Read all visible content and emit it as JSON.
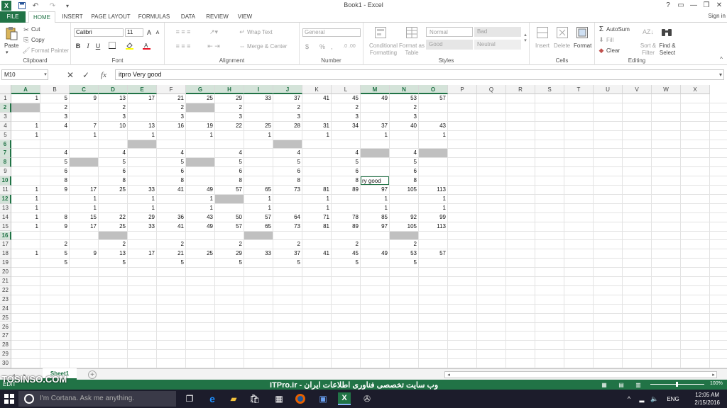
{
  "titlebar": {
    "title": "Book1 - Excel",
    "help": "?",
    "minimize": "—",
    "restore": "❐",
    "close": "✕"
  },
  "tabs": [
    "FILE",
    "HOME",
    "INSERT",
    "PAGE LAYOUT",
    "FORMULAS",
    "DATA",
    "REVIEW",
    "VIEW"
  ],
  "active_tab": "HOME",
  "signin": "Sign in",
  "ribbon": {
    "clipboard": {
      "label": "Clipboard",
      "paste": "Paste",
      "cut": "Cut",
      "copy": "Copy",
      "format_painter": "Format Painter"
    },
    "font": {
      "label": "Font",
      "name": "Calibri",
      "size": "11",
      "bold": "B",
      "italic": "I",
      "underline": "U"
    },
    "alignment": {
      "label": "Alignment",
      "wrap": "Wrap Text",
      "merge": "Merge & Center"
    },
    "number": {
      "label": "Number",
      "format": "General",
      "currency": "$",
      "percent": "%",
      "comma": ","
    },
    "styles": {
      "label": "Styles",
      "conditional": "Conditional Formatting",
      "format_table": "Format as Table",
      "normal": "Normal",
      "bad": "Bad",
      "good": "Good",
      "neutral": "Neutral"
    },
    "cells": {
      "label": "Cells",
      "insert": "Insert",
      "delete": "Delete",
      "format": "Format"
    },
    "editing": {
      "label": "Editing",
      "autosum": "AutoSum",
      "fill": "Fill",
      "clear": "Clear",
      "sort": "Sort & Filter",
      "find": "Find & Select"
    }
  },
  "formula_bar": {
    "name_box": "M10",
    "fx": "fx",
    "value": "itpro Very good"
  },
  "columns": [
    "A",
    "B",
    "C",
    "D",
    "E",
    "F",
    "G",
    "H",
    "I",
    "J",
    "K",
    "L",
    "M",
    "N",
    "O",
    "P",
    "Q",
    "R",
    "S",
    "T",
    "U",
    "V",
    "W",
    "X"
  ],
  "selected_columns": [
    "A",
    "C",
    "D",
    "E",
    "G",
    "H",
    "I",
    "J",
    "M",
    "N",
    "O"
  ],
  "rows": [
    "1",
    "2",
    "3",
    "4",
    "5",
    "6",
    "7",
    "8",
    "9",
    "10",
    "11",
    "12",
    "13",
    "14",
    "15",
    "16",
    "17",
    "18",
    "19",
    "20",
    "21",
    "22",
    "23",
    "24",
    "25",
    "26",
    "27",
    "28",
    "29",
    "30"
  ],
  "selected_rows": [
    "2",
    "6",
    "7",
    "8",
    "10",
    "12",
    "16"
  ],
  "cells": [
    [
      "1",
      "5",
      "9",
      "13",
      "17",
      "21",
      "25",
      "29",
      "33",
      "37",
      "41",
      "45",
      "49",
      "53",
      "57"
    ],
    [
      "",
      "2",
      "",
      "2",
      "",
      "2",
      "",
      "2",
      "",
      "2",
      "",
      "2",
      "",
      "2",
      ""
    ],
    [
      "",
      "3",
      "",
      "3",
      "",
      "3",
      "",
      "3",
      "",
      "3",
      "",
      "3",
      "",
      "3",
      ""
    ],
    [
      "1",
      "4",
      "7",
      "10",
      "13",
      "16",
      "19",
      "22",
      "25",
      "28",
      "31",
      "34",
      "37",
      "40",
      "43"
    ],
    [
      "1",
      "",
      "1",
      "",
      "1",
      "",
      "1",
      "",
      "1",
      "",
      "1",
      "",
      "1",
      "",
      "1"
    ],
    [
      "",
      "",
      "",
      "",
      "",
      "",
      "",
      "",
      "",
      "",
      "",
      "",
      "",
      "",
      ""
    ],
    [
      "",
      "4",
      "",
      "4",
      "",
      "4",
      "",
      "4",
      "",
      "4",
      "",
      "4",
      "",
      "4",
      ""
    ],
    [
      "",
      "5",
      "",
      "5",
      "",
      "5",
      "",
      "5",
      "",
      "5",
      "",
      "5",
      "",
      "5",
      ""
    ],
    [
      "",
      "6",
      "",
      "6",
      "",
      "6",
      "",
      "6",
      "",
      "6",
      "",
      "6",
      "",
      "6",
      ""
    ],
    [
      "",
      "8",
      "",
      "8",
      "",
      "8",
      "",
      "8",
      "",
      "8",
      "",
      "8",
      "ry good",
      "8",
      ""
    ],
    [
      "1",
      "9",
      "17",
      "25",
      "33",
      "41",
      "49",
      "57",
      "65",
      "73",
      "81",
      "89",
      "97",
      "105",
      "113"
    ],
    [
      "1",
      "",
      "1",
      "",
      "1",
      "",
      "1",
      "",
      "1",
      "",
      "1",
      "",
      "1",
      "",
      "1"
    ],
    [
      "1",
      "",
      "1",
      "",
      "1",
      "",
      "1",
      "",
      "1",
      "",
      "1",
      "",
      "1",
      "",
      "1"
    ],
    [
      "1",
      "8",
      "15",
      "22",
      "29",
      "36",
      "43",
      "50",
      "57",
      "64",
      "71",
      "78",
      "85",
      "92",
      "99"
    ],
    [
      "1",
      "9",
      "17",
      "25",
      "33",
      "41",
      "49",
      "57",
      "65",
      "73",
      "81",
      "89",
      "97",
      "105",
      "113"
    ],
    [
      "",
      "",
      "",
      "",
      "",
      "",
      "",
      "",
      "",
      "",
      "",
      "",
      "",
      "",
      ""
    ],
    [
      "",
      "2",
      "",
      "2",
      "",
      "2",
      "",
      "2",
      "",
      "2",
      "",
      "2",
      "",
      "2",
      ""
    ],
    [
      "1",
      "5",
      "9",
      "13",
      "17",
      "21",
      "25",
      "29",
      "33",
      "37",
      "41",
      "45",
      "49",
      "53",
      "57"
    ],
    [
      "",
      "5",
      "",
      "5",
      "",
      "5",
      "",
      "5",
      "",
      "5",
      "",
      "5",
      "",
      "5",
      ""
    ]
  ],
  "grey_cells": [
    [
      2,
      0
    ],
    [
      2,
      6
    ],
    [
      6,
      4
    ],
    [
      6,
      9
    ],
    [
      7,
      12
    ],
    [
      7,
      14
    ],
    [
      8,
      2
    ],
    [
      8,
      6
    ],
    [
      12,
      7
    ],
    [
      16,
      3
    ],
    [
      16,
      8
    ],
    [
      16,
      13
    ]
  ],
  "sheet": {
    "tab": "Sheet1",
    "add": "+"
  },
  "status": {
    "mode": "EDIT",
    "zoom": "100%"
  },
  "overlay": {
    "left": "TOSINSO.COM",
    "center": "ITPro.ir - وب سایت تخصصی فناوری اطلاعات ایران"
  },
  "taskbar": {
    "cortana": "I'm Cortana. Ask me anything.",
    "lang": "ENG",
    "time": "12:05 AM",
    "date": "2/15/2016"
  },
  "colors": {
    "excel_green": "#217346",
    "grey_fill": "#c0c0c0"
  }
}
